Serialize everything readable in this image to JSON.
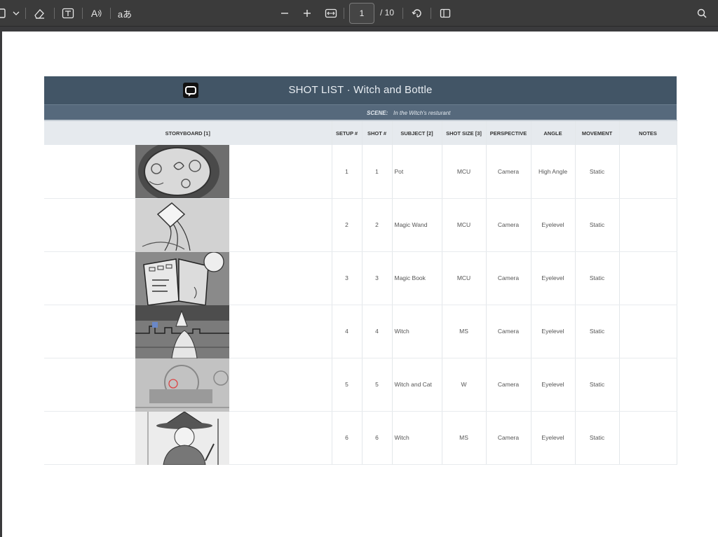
{
  "toolbar": {
    "page_current": "1",
    "page_total": "/ 10",
    "read_aloud_label": "A",
    "translate_label": "aあ",
    "icons": [
      "sidebar-icon",
      "chevron-down-icon",
      "eraser-icon",
      "text-box-icon",
      "read-aloud-icon",
      "translate-icon",
      "zoom-out-icon",
      "zoom-in-icon",
      "fit-width-icon",
      "rotate-icon",
      "two-page-icon",
      "search-icon"
    ]
  },
  "document": {
    "title": "SHOT LIST · Witch and Bottle",
    "scene_label": "SCENE:",
    "scene_value": "In the Witch's resturant",
    "columns": [
      "STORYBOARD [1]",
      "SETUP #",
      "SHOT #",
      "SUBJECT [2]",
      "SHOT SIZE [3]",
      "PERSPECTIVE",
      "ANGLE",
      "MOVEMENT",
      "NOTES"
    ],
    "rows": [
      {
        "setup": "1",
        "shot": "1",
        "subject": "Pot",
        "size": "MCU",
        "perspective": "Camera",
        "angle": "High Angle",
        "movement": "Static",
        "notes": ""
      },
      {
        "setup": "2",
        "shot": "2",
        "subject": "Magic Wand",
        "size": "MCU",
        "perspective": "Camera",
        "angle": "Eyelevel",
        "movement": "Static",
        "notes": ""
      },
      {
        "setup": "3",
        "shot": "3",
        "subject": "Magic Book",
        "size": "MCU",
        "perspective": "Camera",
        "angle": "Eyelevel",
        "movement": "Static",
        "notes": ""
      },
      {
        "setup": "4",
        "shot": "4",
        "subject": "Witch",
        "size": "MS",
        "perspective": "Camera",
        "angle": "Eyelevel",
        "movement": "Static",
        "notes": ""
      },
      {
        "setup": "5",
        "shot": "5",
        "subject": "Witch and Cat",
        "size": "W",
        "perspective": "Camera",
        "angle": "Eyelevel",
        "movement": "Static",
        "notes": ""
      },
      {
        "setup": "6",
        "shot": "6",
        "subject": "Witch",
        "size": "MS",
        "perspective": "Camera",
        "angle": "Eyelevel",
        "movement": "Static",
        "notes": ""
      }
    ]
  }
}
